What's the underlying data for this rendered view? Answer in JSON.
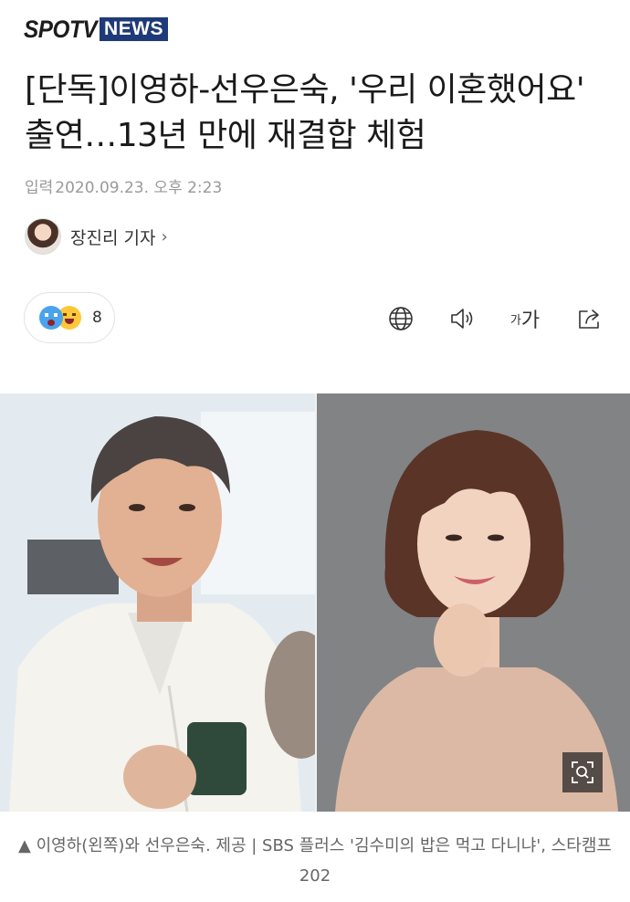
{
  "brand": {
    "part1": "SPOTV",
    "part2": "NEWS"
  },
  "article": {
    "title": "[단독]이영하-선우은숙, '우리 이혼했어요' 출연…13년 만에 재결합 체험",
    "date_label": "입력",
    "date": "2020.09.23. 오후 2:23",
    "reporter": "장진리 기자"
  },
  "reactions": {
    "count": "8"
  },
  "toolbar": {
    "font_small": "가",
    "font_big": "가"
  },
  "photo": {
    "caption": "▲ 이영하(왼쪽)와 선우은숙. 제공 | SBS 플러스 '김수미의 밥은 먹고 다니냐', 스타캠프202"
  },
  "colors": {
    "brand_blue": "#1f3a78",
    "meta_gray": "#9a9a9a"
  }
}
